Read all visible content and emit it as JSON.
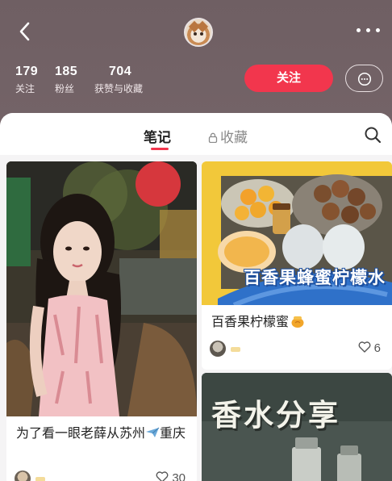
{
  "profile": {
    "stats": [
      {
        "num": "179",
        "label": "关注"
      },
      {
        "num": "185",
        "label": "粉丝"
      },
      {
        "num": "704",
        "label": "获赞与收藏"
      }
    ],
    "follow_label": "关注"
  },
  "tabs": {
    "notes": "笔记",
    "collections": "收藏"
  },
  "notes": [
    {
      "title": "为了看一眼老薛从苏州",
      "title_end": "重庆",
      "likes": "30"
    },
    {
      "title": "百香果柠檬蜜",
      "likes": "6",
      "image_caption": "百香果蜂蜜柠檬水"
    },
    {
      "image_caption": "香水分享"
    }
  ],
  "colors": {
    "accent": "#f2364d",
    "header_bg": "#7a696d"
  }
}
